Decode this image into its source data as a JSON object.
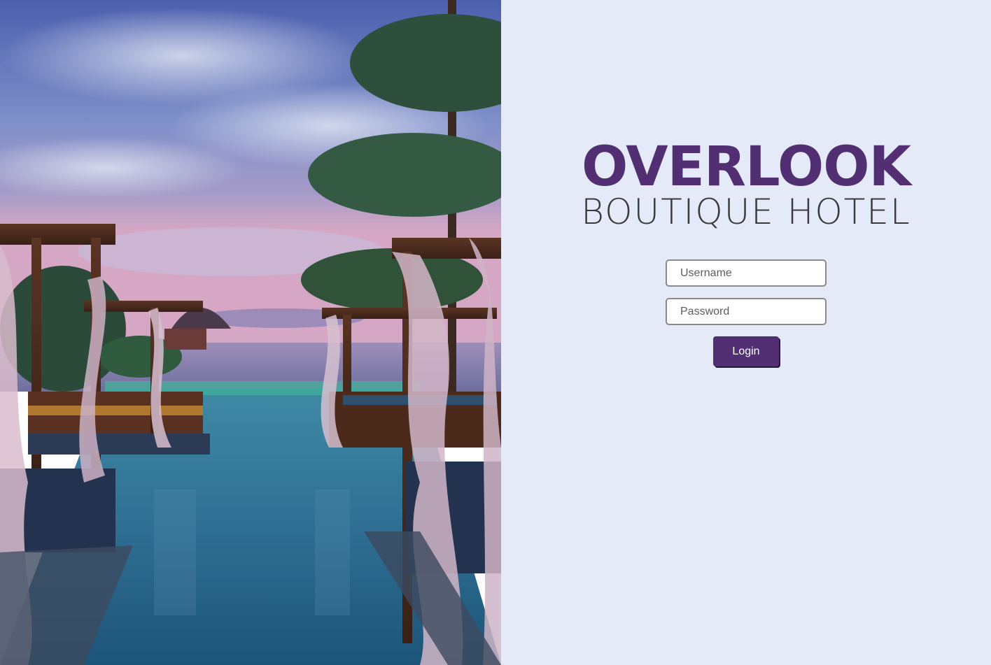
{
  "hero": {
    "image": "resort-infinity-pool-sunset-photo"
  },
  "brand": {
    "title": "OVERLOOK",
    "subtitle": "BOUTIQUE HOTEL"
  },
  "login": {
    "username_placeholder": "Username",
    "username_value": "",
    "password_placeholder": "Password",
    "password_value": "",
    "submit_label": "Login"
  },
  "colors": {
    "brand_purple": "#522e72",
    "panel_background": "#e5eaf9",
    "subtitle_text": "#3a3a3a"
  }
}
